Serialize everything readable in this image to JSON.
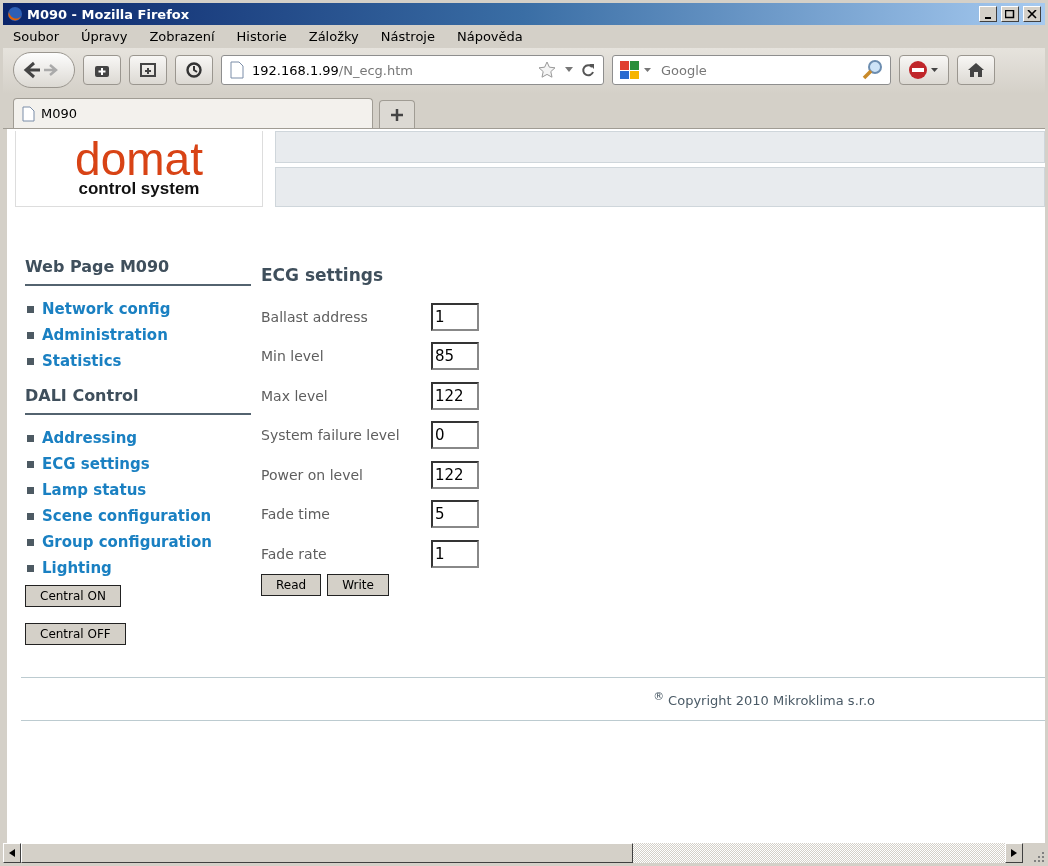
{
  "window": {
    "title": "M090 - Mozilla Firefox"
  },
  "menu": [
    "Soubor",
    "Úpravy",
    "Zobrazení",
    "Historie",
    "Záložky",
    "Nástroje",
    "Nápověda"
  ],
  "address": {
    "host": "192.168.1.99",
    "path": "/N_ecg.htm"
  },
  "search": {
    "placeholder": "Google"
  },
  "tabs": [
    {
      "label": "M090",
      "selected": true
    }
  ],
  "logo": {
    "name": "domat",
    "tagline": "control system"
  },
  "sidebar": [
    {
      "heading": "Web Page M090",
      "links": [
        "Network config",
        "Administration",
        "Statistics"
      ]
    },
    {
      "heading": "DALI Control",
      "links": [
        "Addressing",
        "ECG settings",
        "Lamp status",
        "Scene configuration",
        "Group configuration",
        "Lighting"
      ]
    }
  ],
  "side_buttons": [
    "Central ON",
    "Central OFF"
  ],
  "form": {
    "title": "ECG settings",
    "fields": [
      {
        "label": "Ballast address",
        "value": "1"
      },
      {
        "label": "Min level",
        "value": "85"
      },
      {
        "label": "Max level",
        "value": "122"
      },
      {
        "label": "System failure level",
        "value": "0"
      },
      {
        "label": "Power on level",
        "value": "122"
      },
      {
        "label": "Fade time",
        "value": "5"
      },
      {
        "label": "Fade rate",
        "value": "1"
      }
    ],
    "buttons": [
      "Read",
      "Write"
    ]
  },
  "footer": "$^{®}$ Copyright 2010 Mikroklima s.r.o"
}
